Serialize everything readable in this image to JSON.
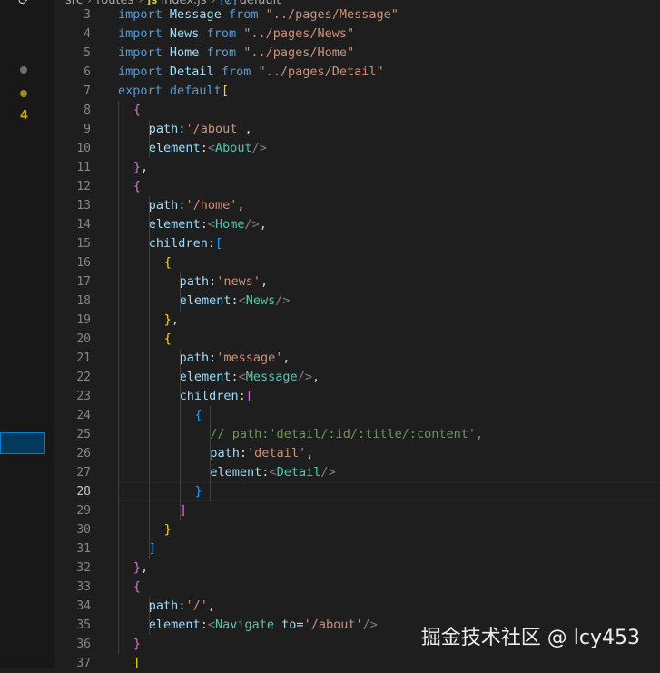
{
  "breadcrumb": {
    "parts": [
      "src",
      "routes",
      "index.js",
      "default"
    ],
    "file_badge": "JS",
    "symbol_badge": "[⊘]"
  },
  "sidebar": {
    "badge_count": "4"
  },
  "code": {
    "active_line": 28,
    "lines": [
      {
        "n": 3,
        "indent": 0,
        "tokens": [
          [
            "kw",
            "import"
          ],
          [
            "plain",
            " "
          ],
          [
            "id",
            "Message"
          ],
          [
            "plain",
            " "
          ],
          [
            "kw",
            "from"
          ],
          [
            "plain",
            " "
          ],
          [
            "str",
            "\"../pages/Message\""
          ]
        ]
      },
      {
        "n": 4,
        "indent": 0,
        "tokens": [
          [
            "kw",
            "import"
          ],
          [
            "plain",
            " "
          ],
          [
            "id",
            "News"
          ],
          [
            "plain",
            " "
          ],
          [
            "kw",
            "from"
          ],
          [
            "plain",
            " "
          ],
          [
            "str",
            "\"../pages/News\""
          ]
        ]
      },
      {
        "n": 5,
        "indent": 0,
        "tokens": [
          [
            "kw",
            "import"
          ],
          [
            "plain",
            " "
          ],
          [
            "id",
            "Home"
          ],
          [
            "plain",
            " "
          ],
          [
            "kw",
            "from"
          ],
          [
            "plain",
            " "
          ],
          [
            "str",
            "\"../pages/Home\""
          ]
        ]
      },
      {
        "n": 6,
        "indent": 0,
        "tokens": [
          [
            "kw",
            "import"
          ],
          [
            "plain",
            " "
          ],
          [
            "id",
            "Detail"
          ],
          [
            "plain",
            " "
          ],
          [
            "kw",
            "from"
          ],
          [
            "plain",
            " "
          ],
          [
            "str",
            "\"../pages/Detail\""
          ]
        ]
      },
      {
        "n": 7,
        "indent": 0,
        "tokens": [
          [
            "kw",
            "export"
          ],
          [
            "plain",
            " "
          ],
          [
            "kw",
            "default"
          ],
          [
            "b1",
            "["
          ]
        ]
      },
      {
        "n": 8,
        "indent": 1,
        "tokens": [
          [
            "b2",
            "{"
          ]
        ]
      },
      {
        "n": 9,
        "indent": 2,
        "tokens": [
          [
            "id",
            "path"
          ],
          [
            "plain",
            ":"
          ],
          [
            "str",
            "'/about'"
          ],
          [
            "plain",
            ","
          ]
        ]
      },
      {
        "n": 10,
        "indent": 2,
        "tokens": [
          [
            "id",
            "element"
          ],
          [
            "plain",
            ":"
          ],
          [
            "pun",
            "<"
          ],
          [
            "tag",
            "About"
          ],
          [
            "pun",
            "/>"
          ]
        ]
      },
      {
        "n": 11,
        "indent": 1,
        "tokens": [
          [
            "b2",
            "}"
          ],
          [
            "plain",
            ","
          ]
        ]
      },
      {
        "n": 12,
        "indent": 1,
        "tokens": [
          [
            "b2",
            "{"
          ]
        ]
      },
      {
        "n": 13,
        "indent": 2,
        "tokens": [
          [
            "id",
            "path"
          ],
          [
            "plain",
            ":"
          ],
          [
            "str",
            "'/home'"
          ],
          [
            "plain",
            ","
          ]
        ]
      },
      {
        "n": 14,
        "indent": 2,
        "tokens": [
          [
            "id",
            "element"
          ],
          [
            "plain",
            ":"
          ],
          [
            "pun",
            "<"
          ],
          [
            "tag",
            "Home"
          ],
          [
            "pun",
            "/>"
          ],
          [
            "plain",
            ","
          ]
        ]
      },
      {
        "n": 15,
        "indent": 2,
        "tokens": [
          [
            "id",
            "children"
          ],
          [
            "plain",
            ":"
          ],
          [
            "b3",
            "["
          ]
        ]
      },
      {
        "n": 16,
        "indent": 3,
        "tokens": [
          [
            "b1",
            "{"
          ]
        ]
      },
      {
        "n": 17,
        "indent": 4,
        "tokens": [
          [
            "id",
            "path"
          ],
          [
            "plain",
            ":"
          ],
          [
            "str",
            "'news'"
          ],
          [
            "plain",
            ","
          ]
        ]
      },
      {
        "n": 18,
        "indent": 4,
        "tokens": [
          [
            "id",
            "element"
          ],
          [
            "plain",
            ":"
          ],
          [
            "pun",
            "<"
          ],
          [
            "tag",
            "News"
          ],
          [
            "pun",
            "/>"
          ]
        ]
      },
      {
        "n": 19,
        "indent": 3,
        "tokens": [
          [
            "b1",
            "}"
          ],
          [
            "plain",
            ","
          ]
        ]
      },
      {
        "n": 20,
        "indent": 3,
        "tokens": [
          [
            "b1",
            "{"
          ]
        ]
      },
      {
        "n": 21,
        "indent": 4,
        "tokens": [
          [
            "id",
            "path"
          ],
          [
            "plain",
            ":"
          ],
          [
            "str",
            "'message'"
          ],
          [
            "plain",
            ","
          ]
        ]
      },
      {
        "n": 22,
        "indent": 4,
        "tokens": [
          [
            "id",
            "element"
          ],
          [
            "plain",
            ":"
          ],
          [
            "pun",
            "<"
          ],
          [
            "tag",
            "Message"
          ],
          [
            "pun",
            "/>"
          ],
          [
            "plain",
            ","
          ]
        ]
      },
      {
        "n": 23,
        "indent": 4,
        "tokens": [
          [
            "id",
            "children"
          ],
          [
            "plain",
            ":"
          ],
          [
            "b2",
            "["
          ]
        ]
      },
      {
        "n": 24,
        "indent": 5,
        "tokens": [
          [
            "b3",
            "{"
          ]
        ]
      },
      {
        "n": 25,
        "indent": 6,
        "tokens": [
          [
            "cmt",
            "// path:'detail/:id/:title/:content',"
          ]
        ]
      },
      {
        "n": 26,
        "indent": 6,
        "tokens": [
          [
            "id",
            "path"
          ],
          [
            "plain",
            ":"
          ],
          [
            "str",
            "'detail'"
          ],
          [
            "plain",
            ","
          ]
        ]
      },
      {
        "n": 27,
        "indent": 6,
        "tokens": [
          [
            "id",
            "element"
          ],
          [
            "plain",
            ":"
          ],
          [
            "pun",
            "<"
          ],
          [
            "tag",
            "Detail"
          ],
          [
            "pun",
            "/>"
          ]
        ]
      },
      {
        "n": 28,
        "indent": 5,
        "tokens": [
          [
            "b3",
            "}"
          ]
        ]
      },
      {
        "n": 29,
        "indent": 4,
        "tokens": [
          [
            "b2",
            "]"
          ]
        ]
      },
      {
        "n": 30,
        "indent": 3,
        "tokens": [
          [
            "b1",
            "}"
          ]
        ]
      },
      {
        "n": 31,
        "indent": 2,
        "tokens": [
          [
            "b3",
            "]"
          ]
        ]
      },
      {
        "n": 32,
        "indent": 1,
        "tokens": [
          [
            "b2",
            "}"
          ],
          [
            "plain",
            ","
          ]
        ]
      },
      {
        "n": 33,
        "indent": 1,
        "tokens": [
          [
            "b2",
            "{"
          ]
        ]
      },
      {
        "n": 34,
        "indent": 2,
        "tokens": [
          [
            "id",
            "path"
          ],
          [
            "plain",
            ":"
          ],
          [
            "str",
            "'/'"
          ],
          [
            "plain",
            ","
          ]
        ]
      },
      {
        "n": 35,
        "indent": 2,
        "tokens": [
          [
            "id",
            "element"
          ],
          [
            "plain",
            ":"
          ],
          [
            "pun",
            "<"
          ],
          [
            "tag",
            "Navigate"
          ],
          [
            "plain",
            " "
          ],
          [
            "id",
            "to"
          ],
          [
            "plain",
            "="
          ],
          [
            "str",
            "'/about'"
          ],
          [
            "pun",
            "/>"
          ]
        ]
      },
      {
        "n": 36,
        "indent": 1,
        "tokens": [
          [
            "b2",
            "}"
          ]
        ]
      },
      {
        "n": 37,
        "indent": 0,
        "tokens": [
          [
            "plain",
            "  "
          ],
          [
            "b1",
            "]"
          ]
        ]
      }
    ]
  },
  "watermark": "掘金技术社区 @ lcy453"
}
